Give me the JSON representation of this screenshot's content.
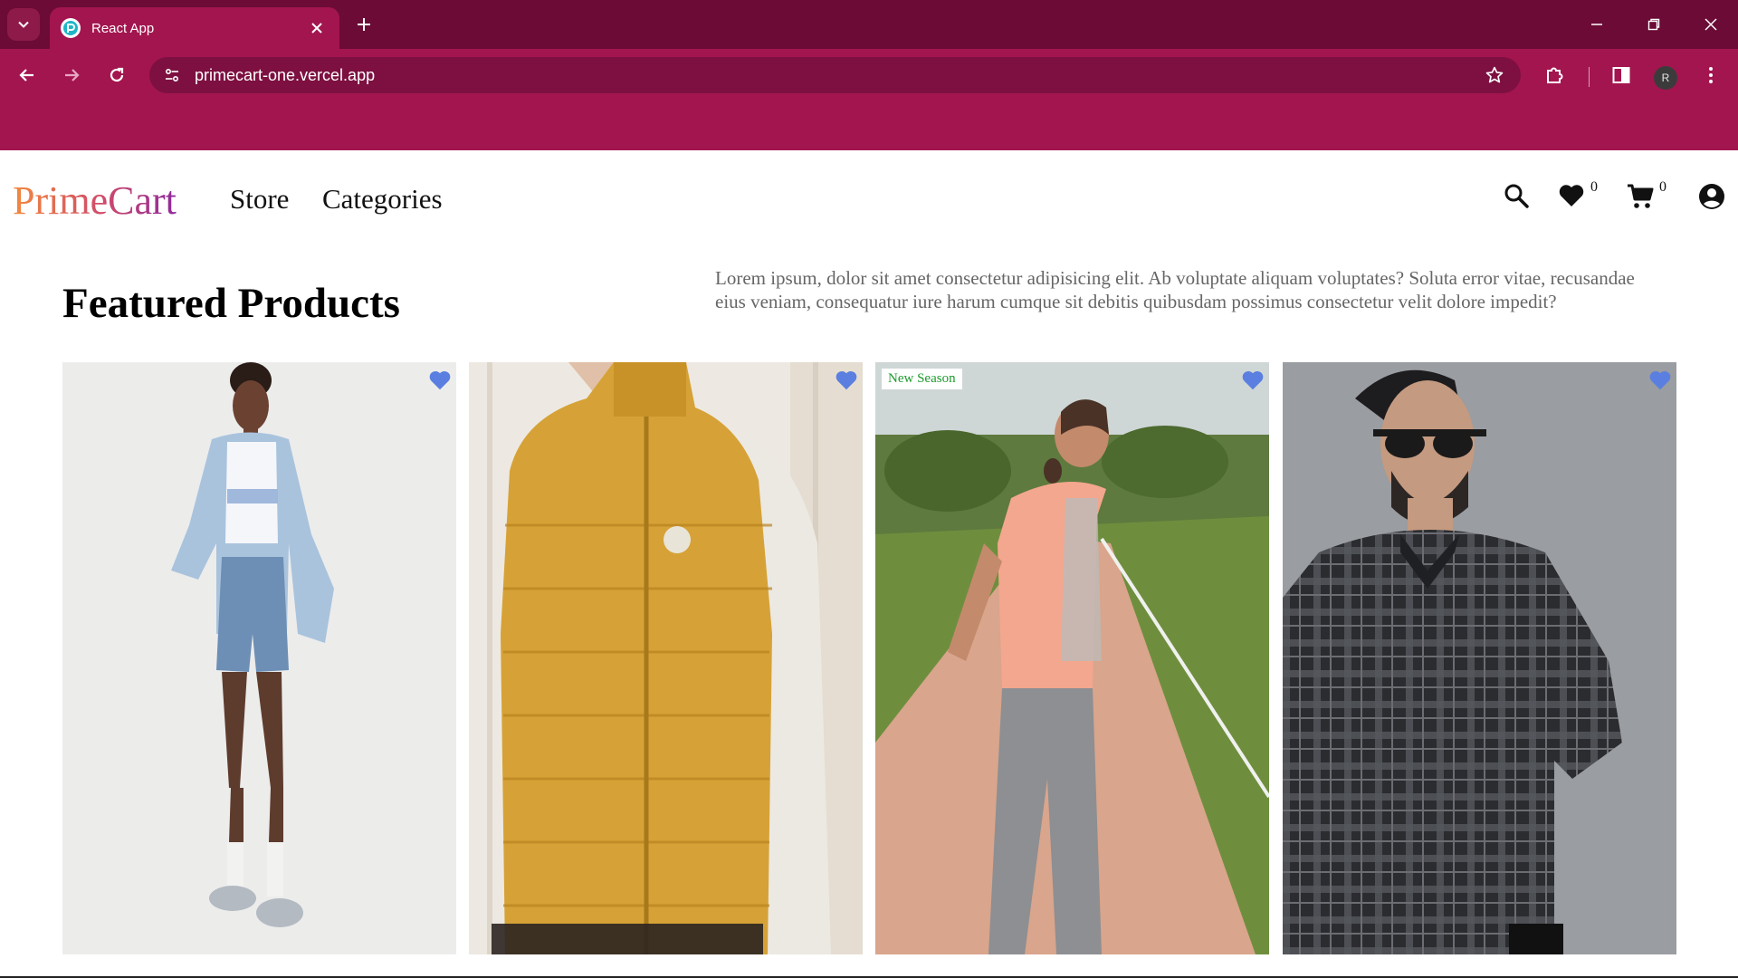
{
  "browser": {
    "tab_title": "React App",
    "url": "primecart-one.vercel.app",
    "profile_initial": "R",
    "frame_color": "#6b0b36",
    "toolbar_color": "#a3154f"
  },
  "header": {
    "logo": "PrimeCart",
    "nav": [
      "Store",
      "Categories"
    ],
    "wishlist_count": "0",
    "cart_count": "0",
    "icons": [
      "search-icon",
      "heart-icon",
      "cart-icon",
      "account-icon"
    ]
  },
  "featured": {
    "title": "Featured Products",
    "description": "Lorem ipsum, dolor sit amet consectetur adipisicing elit. Ab voluptate aliquam voluptates? Soluta error vitae, recusandae eius veniam, consequatur iure harum cumque sit debitis quibusdam possimus consectetur velit dolore impedit?",
    "badge": "New Season",
    "heart_color": "#5a7fe0",
    "products": [
      {
        "image": "woman in denim jacket and shorts"
      },
      {
        "image": "mustard quilted puffer vest"
      },
      {
        "image": "woman jogging in peach running tee"
      },
      {
        "image": "man in black checked shirt and sunglasses"
      }
    ]
  }
}
